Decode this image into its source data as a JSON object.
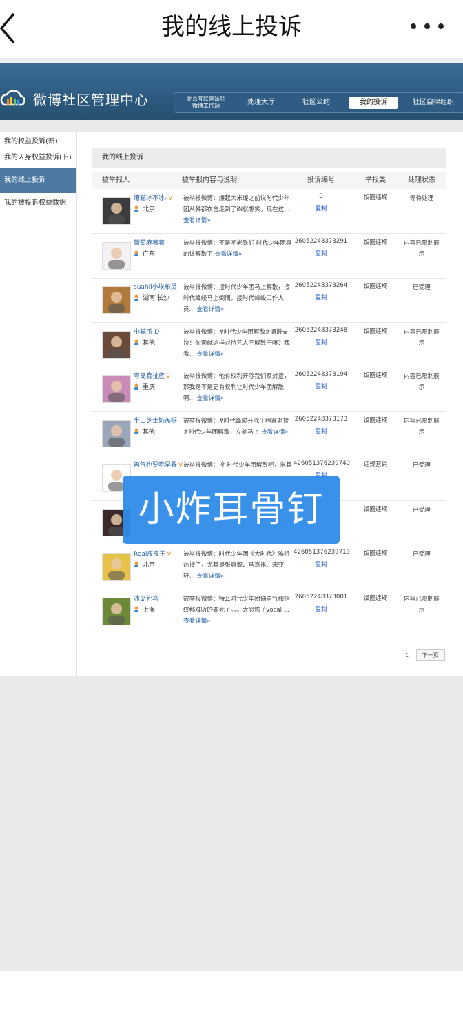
{
  "appbar": {
    "title": "我的线上投诉"
  },
  "banner": {
    "brand": "微博社区管理中心",
    "nav": [
      "北京互联网法院\n微博工作站",
      "处理大厅",
      "社区公约",
      "我的投诉",
      "社区自律组织"
    ],
    "active_nav": "我的投诉"
  },
  "sidebar": {
    "items": [
      "我的权益投诉(新)",
      "我的人身权益投诉(旧)",
      "我的线上投诉",
      "我的被投诉权益数据"
    ],
    "active": "我的线上投诉"
  },
  "section_title": "我的线上投诉",
  "table": {
    "headers": [
      "被举报人",
      "被举报内容与说明",
      "投诉编号",
      "举报类",
      "处理状态"
    ],
    "copy_label": "复制",
    "rows": [
      {
        "user": "燎猫冰不冰-",
        "vip": "V",
        "location": "北京",
        "content": "被举报微博：爆起大米爆之前说时代少年团从韩都衣舍走到了iN就想笑，现在这...",
        "link": "查看详情»",
        "number": "0",
        "type": "饭圈违规",
        "status": "等待处理"
      },
      {
        "user": "葡萄麻薯薯",
        "vip": "",
        "location": "广东",
        "content": "被举报微博：不是吧老铁们 时代少年团真的该解散了",
        "link": "查看详情»",
        "number": "26052248373291",
        "type": "饭圈违规",
        "status": "内容已限制展示"
      },
      {
        "user": "suahll小埃布灵",
        "vip": "",
        "location": "湖南 长沙",
        "content": "被举报微博：接时代少年团马上解散，接时代峰峻马上倒闭，接时代峰峻工作人员...",
        "link": "查看详情»",
        "number": "26052248373264",
        "type": "饭圈违规",
        "status": "已受理"
      },
      {
        "user": "小猫爪-D",
        "vip": "",
        "location": "其他",
        "content": "被举报微博：#时代少年团解散#据报支持！你司就这样对待艺人不解散干嘛？我看...",
        "link": "查看详情»",
        "number": "26052248373248",
        "type": "饭圈违规",
        "status": "内容已限制展示"
      },
      {
        "user": "粤岛鑫祉旌",
        "vip": "V",
        "location": "重庆",
        "content": "被举报微博：他有权利开除我们家对接，那我是不是更有权利让时代少年团解散啊...",
        "link": "查看详情»",
        "number": "26052248373194",
        "type": "饭圈违规",
        "status": "内容已限制展示"
      },
      {
        "user": "半口芝士奶盖呀",
        "vip": "",
        "location": "其他",
        "content": "被举报微博：#时代峰峻开除丁程鑫对接#时代少年团解散，立刻马上",
        "link": "查看详情»",
        "number": "26052248373173",
        "type": "饭圈违规",
        "status": "内容已限制展示"
      },
      {
        "user": "再气也要吃早餐",
        "vip": "V",
        "location": "",
        "content": "被举报微博：投 时代少年团解散吧，拖其",
        "link": "",
        "number": "426051376239740",
        "type": "违规营销",
        "status": "已受理"
      },
      {
        "user": "",
        "vip": "",
        "location": "",
        "content": "",
        "link": "",
        "number": "",
        "type": "饭圈违规",
        "status": "已受理"
      },
      {
        "user": "Real皮皮王",
        "vip": "V",
        "location": "北京",
        "content": "被举报微博：时代少年团《大时代》难听热搜了，尤其是张真源、马嘉祺、宋亚轩...",
        "link": "查看详情»",
        "number": "426051376239719",
        "type": "饭圈违规",
        "status": "已受理"
      },
      {
        "user": "冰岛死鸟",
        "vip": "",
        "location": "上海",
        "content": "被举报微博：特么时代少年团偶勇气和指纹都难听的要死了。。。太恐怖了vocal ...",
        "link": "查看详情»",
        "number": "26052248373001",
        "type": "饭圈违规",
        "status": "内容已限制展示"
      }
    ]
  },
  "pager": {
    "page": "1",
    "next": "下一页"
  },
  "overlay": {
    "text": "小炸耳骨钉"
  },
  "colors": {
    "banner": "#2d5a80",
    "link": "#2a63a6",
    "active_side": "#4c7aa3",
    "overlay": "#2f8ce8"
  }
}
